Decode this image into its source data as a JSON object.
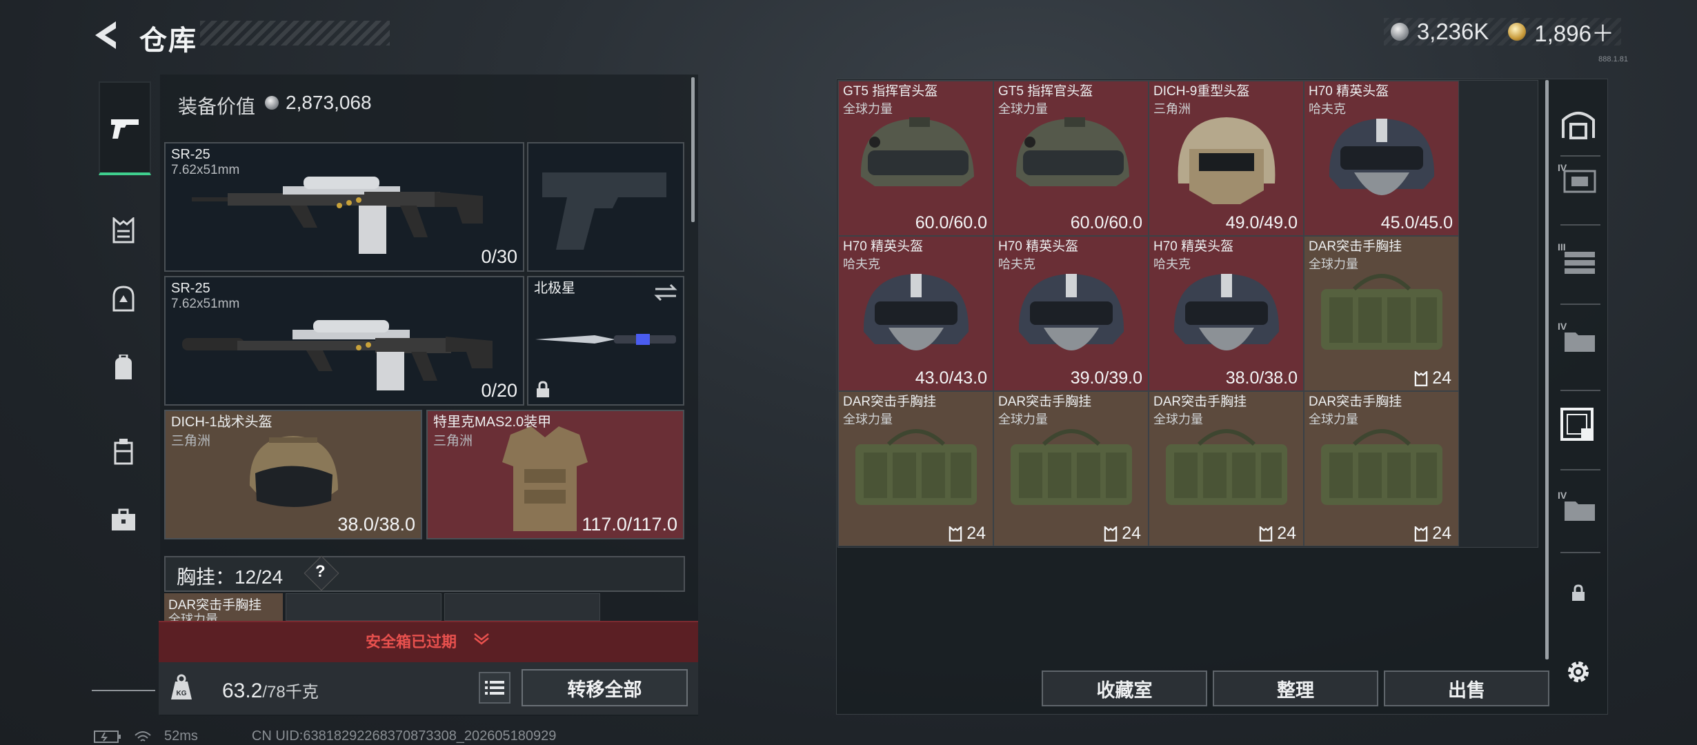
{
  "header": {
    "title": "仓库",
    "currency_silver": "3,236K",
    "currency_gold": "1,896＋",
    "version_text": "888.1.81"
  },
  "loadout": {
    "value_label": "装备价值",
    "value": "2,873,068",
    "slots": [
      {
        "name": "SR-25",
        "sub": "7.62x51mm",
        "count": "0/30"
      },
      {
        "name": "SR-25",
        "sub": "7.62x51mm",
        "count": "0/20"
      },
      {
        "name": "北极星"
      },
      {
        "name": "DICH-1战术头盔",
        "sub": "三角洲",
        "count": "38.0/38.0"
      },
      {
        "name": "特里克MAS2.0装甲",
        "sub": "三角洲",
        "count": "117.0/117.0"
      }
    ],
    "chest_label": "胸挂：12/24",
    "chest_help": "?",
    "partial_item_name": "DAR突击手胸挂",
    "partial_item_sub": "全球力量",
    "banner_text": "安全箱已过期",
    "weight_value": "63.2",
    "weight_max": "/78千克",
    "transfer_all_label": "转移全部"
  },
  "stash": {
    "cells": [
      {
        "name": "GT5 指挥官头盔",
        "sub": "全球力量",
        "dur": "60.0/60.0",
        "color": "red",
        "kind": "helmet-gt5"
      },
      {
        "name": "GT5 指挥官头盔",
        "sub": "全球力量",
        "dur": "60.0/60.0",
        "color": "red",
        "kind": "helmet-gt5"
      },
      {
        "name": "DICH-9重型头盔",
        "sub": "三角洲",
        "dur": "49.0/49.0",
        "color": "red",
        "kind": "helmet-dich9"
      },
      {
        "name": "H70 精英头盔",
        "sub": "哈夫克",
        "dur": "45.0/45.0",
        "color": "red",
        "kind": "helmet-h70"
      },
      {
        "name": "H70 精英头盔",
        "sub": "哈夫克",
        "dur": "43.0/43.0",
        "color": "red",
        "kind": "helmet-h70"
      },
      {
        "name": "H70 精英头盔",
        "sub": "哈夫克",
        "dur": "39.0/39.0",
        "color": "red",
        "kind": "helmet-h70"
      },
      {
        "name": "H70 精英头盔",
        "sub": "哈夫克",
        "dur": "38.0/38.0",
        "color": "red",
        "kind": "helmet-h70"
      },
      {
        "name": "DAR突击手胸挂",
        "sub": "全球力量",
        "cnt": "24",
        "color": "brown",
        "kind": "rig"
      },
      {
        "name": "DAR突击手胸挂",
        "sub": "全球力量",
        "cnt": "24",
        "color": "brown",
        "kind": "rig"
      },
      {
        "name": "DAR突击手胸挂",
        "sub": "全球力量",
        "cnt": "24",
        "color": "brown",
        "kind": "rig"
      },
      {
        "name": "DAR突击手胸挂",
        "sub": "全球力量",
        "cnt": "24",
        "color": "brown",
        "kind": "rig"
      },
      {
        "name": "DAR突击手胸挂",
        "sub": "全球力量",
        "cnt": "24",
        "color": "brown",
        "kind": "rig"
      }
    ],
    "buttons": {
      "collection": "收藏室",
      "sort": "整理",
      "sell": "出售"
    }
  },
  "status_bar": {
    "ping": "52ms",
    "uid": "CN UID:6381829226837087330​8_202605180929"
  },
  "colors": {
    "red_cell": "#6a2f36",
    "brown_cell": "#5c4a3d",
    "accent_green": "#3fcf8e",
    "banner_text": "#e9514e"
  }
}
